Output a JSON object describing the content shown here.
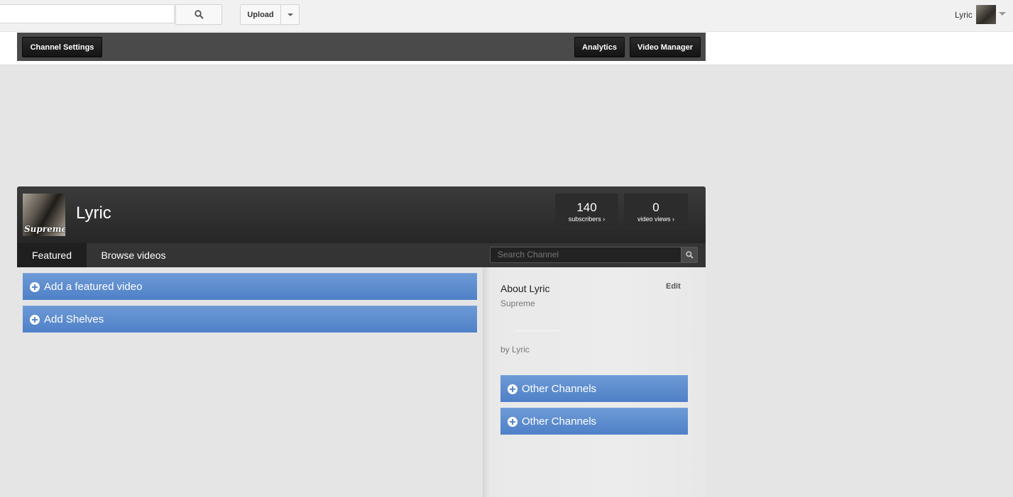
{
  "masthead": {
    "search_value": "",
    "upload_label": "Upload",
    "user_name": "Lyric"
  },
  "owner_bar": {
    "channel_settings_label": "Channel Settings",
    "analytics_label": "Analytics",
    "video_manager_label": "Video Manager"
  },
  "channel": {
    "title": "Lyric",
    "avatar_text": "Supreme",
    "stats": [
      {
        "value": "140",
        "label": "subscribers ›"
      },
      {
        "value": "0",
        "label": "video views ›"
      }
    ],
    "tabs": [
      {
        "label": "Featured",
        "active": true
      },
      {
        "label": "Browse videos",
        "active": false
      }
    ],
    "search_placeholder": "Search Channel"
  },
  "main": {
    "add_featured_label": "Add a featured video",
    "add_shelves_label": "Add Shelves"
  },
  "sidebar": {
    "about_title": "About Lyric",
    "edit_label": "Edit",
    "about_subtitle": "Supreme",
    "by_line": "by Lyric",
    "other_channels": [
      "Other Channels",
      "Other Channels"
    ]
  },
  "colors": {
    "accent_blue": "#5687cc",
    "dark_bar": "#343434"
  }
}
